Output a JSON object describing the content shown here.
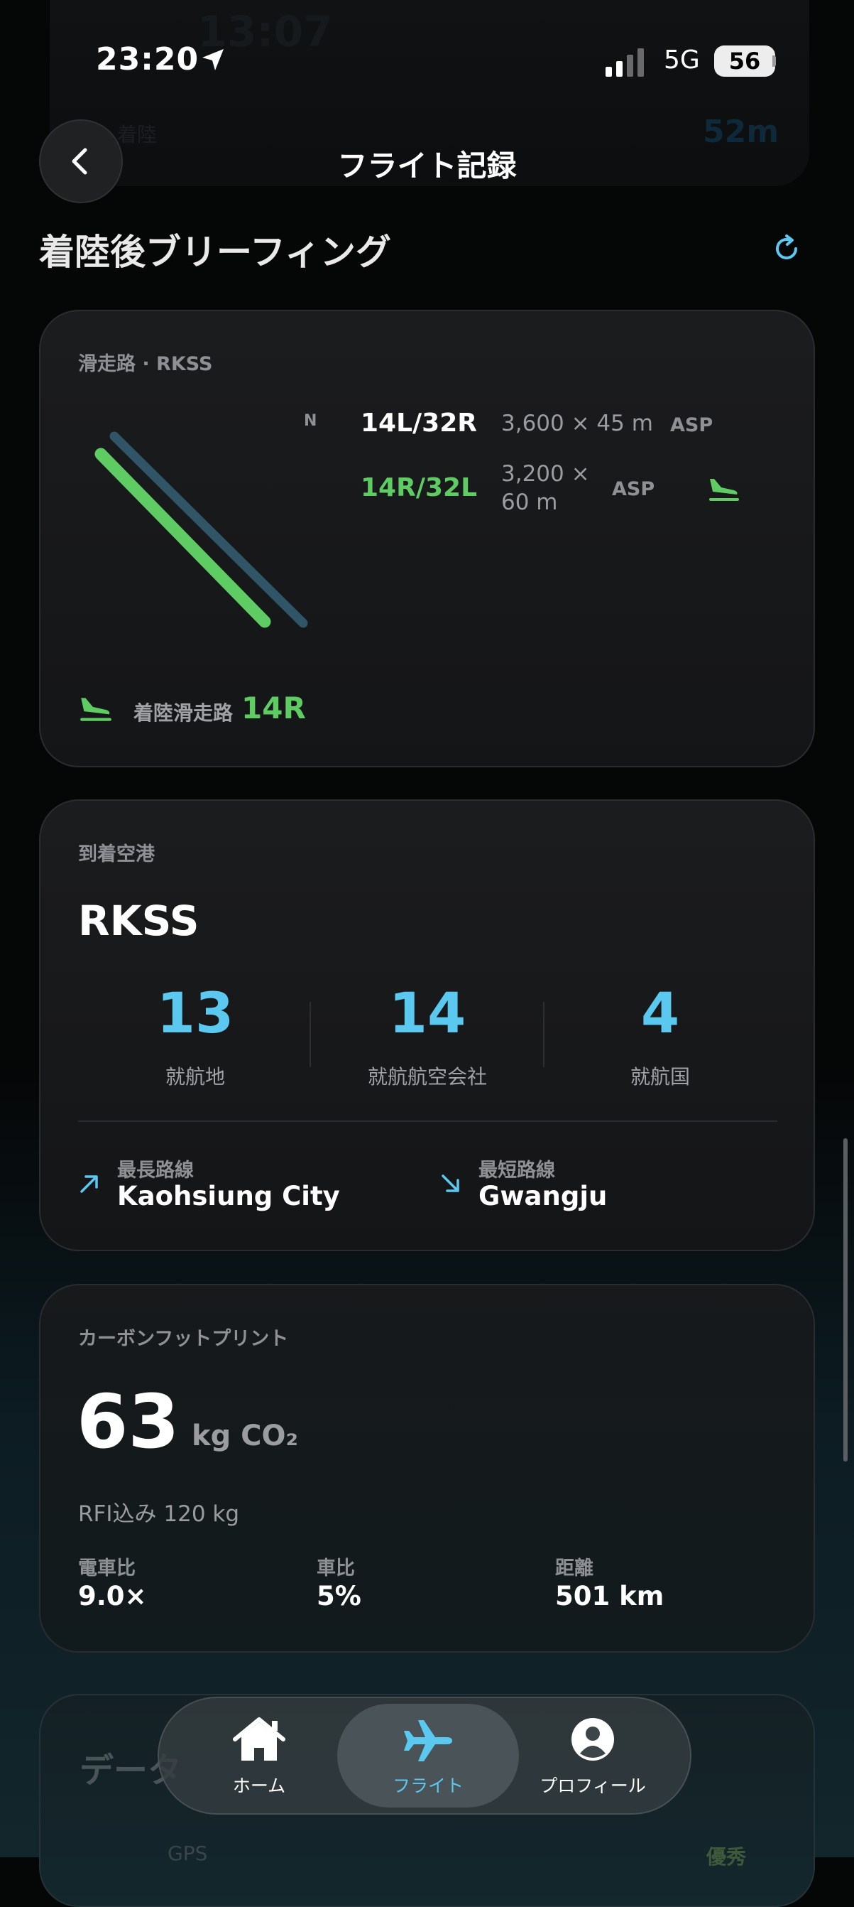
{
  "status_bar": {
    "time": "23:20",
    "network": "5G",
    "battery": "56"
  },
  "ghost": {
    "time": "13:07",
    "duration": "52m",
    "label": "着陸"
  },
  "header": {
    "title": "フライト記録"
  },
  "section": {
    "title": "着陸後ブリーフィング"
  },
  "runway_card": {
    "label": "滑走路 · RKSS",
    "north_label": "N",
    "runways": [
      {
        "name": "14L/32R",
        "dims": "3,600 × 45 m",
        "surface": "ASP",
        "active": false,
        "color": "#2f5567"
      },
      {
        "name": "14R/32L",
        "dims_line1": "3,200 ×",
        "dims_line2": "60 m",
        "surface": "ASP",
        "active": true,
        "color": "#5fcb63"
      }
    ],
    "landing_label": "着陸滑走路",
    "landing_runway": "14R"
  },
  "airport_card": {
    "label": "到着空港",
    "code": "RKSS",
    "stats": [
      {
        "value": "13",
        "label": "就航地"
      },
      {
        "value": "14",
        "label": "就航航空会社"
      },
      {
        "value": "4",
        "label": "就航国"
      }
    ],
    "longest": {
      "label": "最長路線",
      "value": "Kaohsiung City"
    },
    "shortest": {
      "label": "最短路線",
      "value": "Gwangju"
    }
  },
  "carbon_card": {
    "label": "カーボンフットプリント",
    "value": "63",
    "unit": "kg CO₂",
    "rfi": "RFI込み 120 kg",
    "metrics": [
      {
        "label": "電車比",
        "value": "9.0×"
      },
      {
        "label": "車比",
        "value": "5%"
      },
      {
        "label": "距離",
        "value": "501 km"
      }
    ]
  },
  "next_card": {
    "title_partial": "データ",
    "row_label": "GPS",
    "row_value": "優秀"
  },
  "tab_bar": {
    "items": [
      {
        "label": "ホーム",
        "active": false
      },
      {
        "label": "フライト",
        "active": true
      },
      {
        "label": "プロフィール",
        "active": false
      }
    ]
  },
  "colors": {
    "accent_blue": "#5bc8f0",
    "accent_green": "#5fcb63",
    "runway_blue": "#2f5567"
  }
}
